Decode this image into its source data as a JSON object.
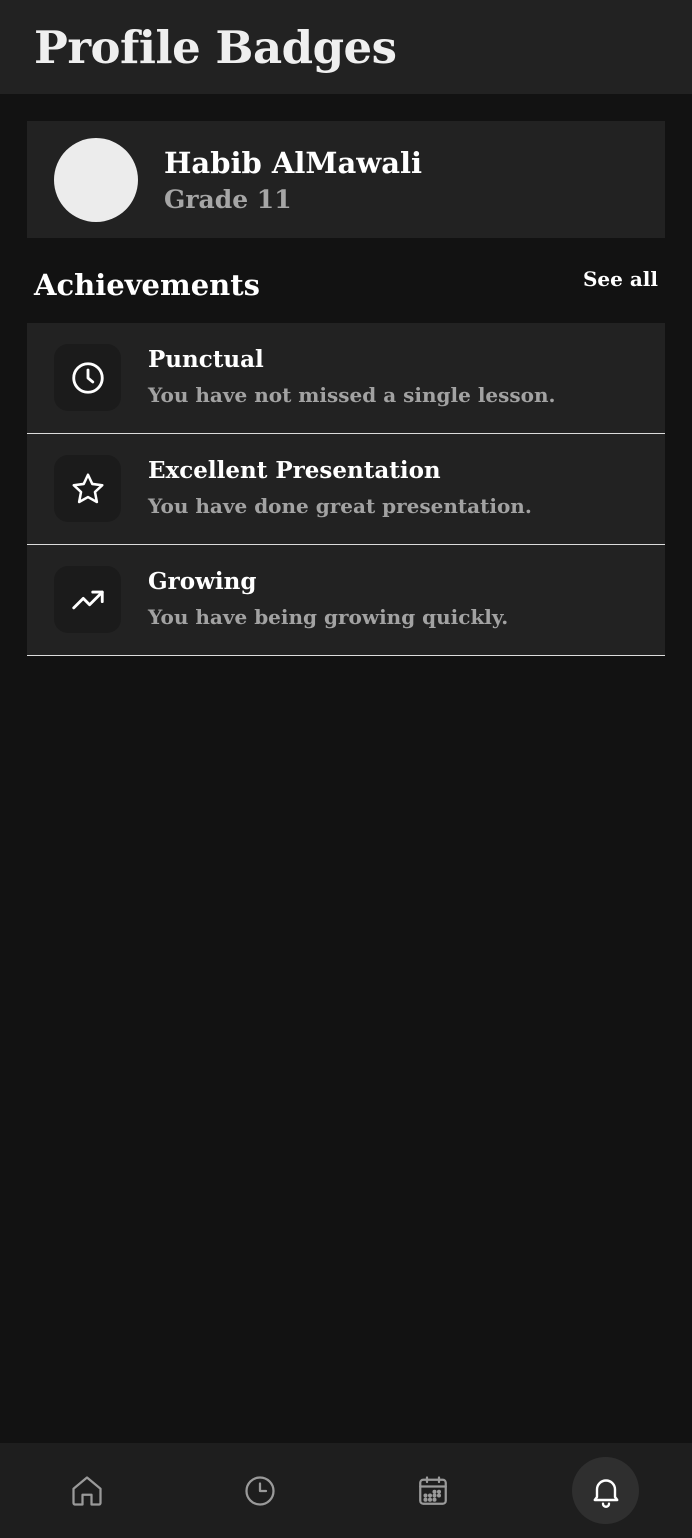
{
  "header": {
    "title": "Profile Badges"
  },
  "profile": {
    "name": "Habib AlMawali",
    "grade": "Grade 11"
  },
  "achievements_section": {
    "title": "Achievements",
    "see_all_label": "See all",
    "items": [
      {
        "icon": "clock-icon",
        "title": "Punctual",
        "description": "You have not missed a single lesson."
      },
      {
        "icon": "star-icon",
        "title": "Excellent Presentation",
        "description": "You have done great presentation."
      },
      {
        "icon": "trending-up-icon",
        "title": "Growing",
        "description": "You have being growing quickly."
      }
    ]
  },
  "bottom_nav": {
    "items": [
      {
        "icon": "home-icon",
        "active": false
      },
      {
        "icon": "clock-icon",
        "active": false
      },
      {
        "icon": "calendar-icon",
        "active": false
      },
      {
        "icon": "bell-icon",
        "active": true
      }
    ]
  },
  "colors": {
    "background": "#121212",
    "card": "#222222",
    "muted_text": "#a6a6a6",
    "avatar": "#ececec"
  }
}
